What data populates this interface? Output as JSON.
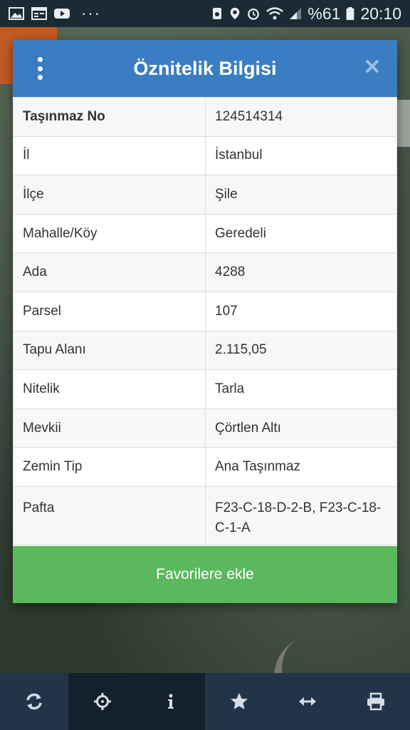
{
  "status_bar": {
    "left_icons": [
      "image-icon",
      "calendar-icon",
      "youtube-icon"
    ],
    "overflow": "···",
    "right_icons": [
      "recycle-icon",
      "location-icon",
      "alarm-icon",
      "wifi-icon",
      "signal-icon"
    ],
    "battery_percent": "%61",
    "time": "20:10"
  },
  "dialog": {
    "title": "Öznitelik Bilgisi",
    "menu_icon": "more-vert-icon",
    "close_icon": "close-icon",
    "rows": [
      {
        "key": "Taşınmaz No",
        "value": "124514314"
      },
      {
        "key": "İl",
        "value": "İstanbul"
      },
      {
        "key": "İlçe",
        "value": "Şile"
      },
      {
        "key": "Mahalle/Köy",
        "value": "Geredeli"
      },
      {
        "key": "Ada",
        "value": "4288"
      },
      {
        "key": "Parsel",
        "value": "107"
      },
      {
        "key": "Tapu Alanı",
        "value": "2.115,05"
      },
      {
        "key": "Nitelik",
        "value": "Tarla"
      },
      {
        "key": "Mevkii",
        "value": "Çörtlen Altı"
      },
      {
        "key": "Zemin Tip",
        "value": "Ana Taşınmaz"
      },
      {
        "key": "Pafta",
        "value": "F23-C-18-D-2-B,  F23-C-18-C-1-A"
      }
    ],
    "favorite_button": "Favorilere ekle"
  },
  "toolbar": {
    "buttons": [
      "refresh-icon",
      "crosshair-icon",
      "info-icon",
      "star-icon",
      "measure-icon",
      "print-icon"
    ]
  },
  "colors": {
    "header": "#3a7dc2",
    "favorite": "#5cb85c",
    "status_bar": "#1c2a33",
    "toolbar": "#223548"
  }
}
